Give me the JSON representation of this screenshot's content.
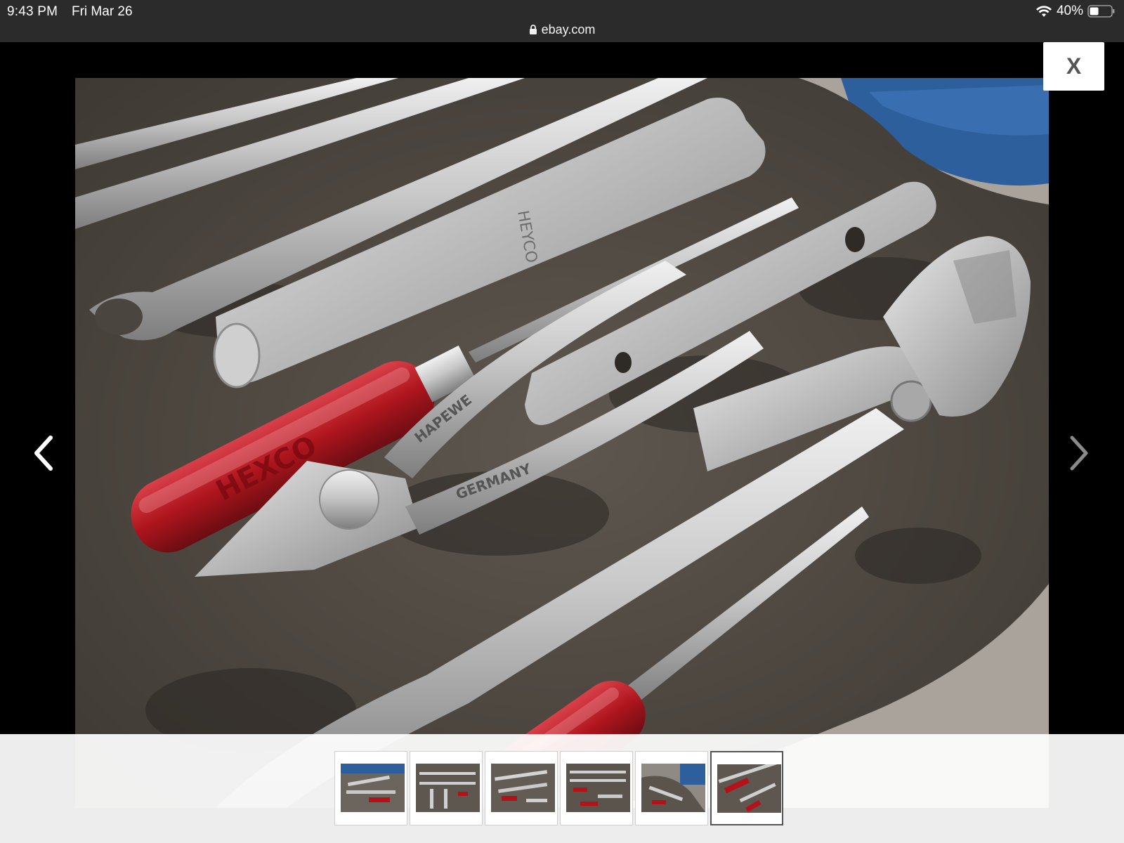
{
  "status_bar": {
    "time": "9:43 PM",
    "date": "Fri Mar 26",
    "battery": "40%",
    "battery_level": 0.4,
    "wifi_icon": "wifi-icon",
    "battery_icon": "battery-icon"
  },
  "browser": {
    "url": "ebay.com",
    "lock_icon": "lock-icon"
  },
  "viewer": {
    "close_label": "X",
    "prev_icon": "chevron-left-icon",
    "next_icon": "chevron-right-icon",
    "image_text": {
      "handle_brand": "HEXCO",
      "pliers_brand": "HAPEWE",
      "pliers_origin": "GERMANY"
    },
    "thumbnails": [
      {
        "selected": false
      },
      {
        "selected": false
      },
      {
        "selected": false
      },
      {
        "selected": false
      },
      {
        "selected": false
      },
      {
        "selected": true
      }
    ]
  },
  "colors": {
    "status_bar_bg": "#2b2b2c",
    "viewer_bg": "#000000",
    "tray": "#5e574f",
    "chrome": "#c9c9c9",
    "red_handle": "#b3121b"
  }
}
